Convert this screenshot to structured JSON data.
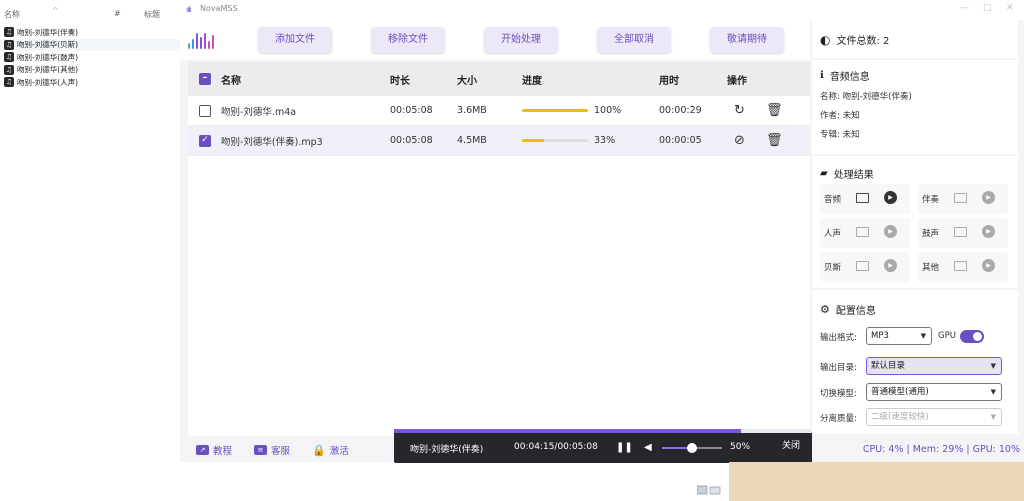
{
  "explorer": {
    "headers": {
      "name": "名称",
      "num": "#",
      "title": "标题"
    },
    "files": [
      {
        "name": "吻别-刘德华(伴奏)",
        "selected": false
      },
      {
        "name": "吻别-刘德华(贝斯)",
        "selected": true
      },
      {
        "name": "吻别-刘德华(鼓声)",
        "selected": false
      },
      {
        "name": "吻别-刘德华(其他)",
        "selected": false
      },
      {
        "name": "吻别-刘德华(人声)",
        "selected": false
      }
    ]
  },
  "app": {
    "title": "NovaMSS",
    "toolbar": {
      "add": "添加文件",
      "remove": "移除文件",
      "start": "开始处理",
      "cancel_all": "全部取消",
      "coming": "敬请期待"
    },
    "table": {
      "headers": {
        "name": "名称",
        "duration": "时长",
        "size": "大小",
        "progress": "进度",
        "elapsed": "用时",
        "actions": "操作"
      },
      "rows": [
        {
          "name": "吻别-刘德华.m4a",
          "duration": "00:05:08",
          "size": "3.6MB",
          "progress": 1.0,
          "progress_text": "100%",
          "elapsed": "00:00:29",
          "checked": false,
          "action": "refresh-icon"
        },
        {
          "name": "吻别-刘德华(伴奏).mp3",
          "duration": "00:05:08",
          "size": "4.5MB",
          "progress": 0.33,
          "progress_text": "33%",
          "elapsed": "00:00:05",
          "checked": true,
          "action": "cancel-icon"
        }
      ]
    },
    "file_count": {
      "label": "文件总数: 2"
    },
    "audio_info": {
      "title": "音频信息",
      "name_line": "名称: 吻别-刘德华(伴奏)",
      "author_line": "作者: 未知",
      "album_line": "专辑: 未知"
    },
    "results": {
      "title": "处理结果",
      "items": [
        {
          "label": "音频",
          "enabled": true
        },
        {
          "label": "伴奏",
          "enabled": false
        },
        {
          "label": "人声",
          "enabled": false
        },
        {
          "label": "鼓声",
          "enabled": false
        },
        {
          "label": "贝斯",
          "enabled": false
        },
        {
          "label": "其他",
          "enabled": false
        }
      ]
    },
    "config": {
      "title": "配置信息",
      "format_label": "输出格式:",
      "format_value": "MP3",
      "gpu_label": "GPU",
      "gpu_on": true,
      "dir_label": "输出目录:",
      "dir_value": "默认目录",
      "model_label": "切换模型:",
      "model_value": "普通模型(通用)",
      "quality_label": "分离质量:",
      "quality_value": "二级(速度较快)"
    },
    "footer": {
      "tutorial": "教程",
      "support": "客服",
      "activate": "激活",
      "status": "CPU: 4% | Mem: 29% | GPU: 10%"
    }
  },
  "player": {
    "track": "吻别-刘德华(伴奏)",
    "time": "00:04:15/00:05:08",
    "position": 0.83,
    "volume": 0.5,
    "volume_text": "50%",
    "close": "关闭"
  },
  "colors": {
    "accent": "#6a4fc0",
    "progress": "#f0bc14",
    "player_bg": "#27262d"
  }
}
